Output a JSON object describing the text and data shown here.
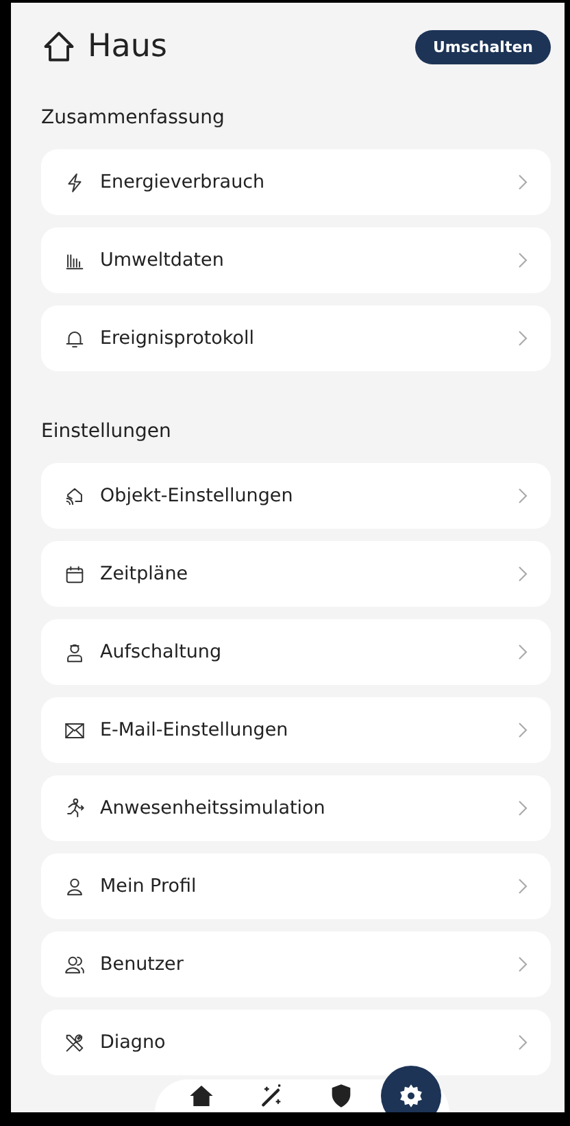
{
  "header": {
    "title": "Haus",
    "button": "Umschalten"
  },
  "sections": [
    {
      "title": "Zusammenfassung",
      "items": [
        {
          "label": "Energieverbrauch"
        },
        {
          "label": "Umweltdaten"
        },
        {
          "label": "Ereignisprotokoll"
        }
      ]
    },
    {
      "title": "Einstellungen",
      "items": [
        {
          "label": "Objekt-Einstellungen"
        },
        {
          "label": "Zeitpläne"
        },
        {
          "label": "Aufschaltung"
        },
        {
          "label": "E-Mail-Einstellungen"
        },
        {
          "label": "Anwesenheitssimulation"
        },
        {
          "label": "Mein Profil"
        },
        {
          "label": "Benutzer"
        },
        {
          "label": "Diagno"
        }
      ]
    }
  ],
  "bottom_nav": [
    {
      "selected": false
    },
    {
      "selected": false
    },
    {
      "selected": false
    },
    {
      "selected": true
    }
  ]
}
